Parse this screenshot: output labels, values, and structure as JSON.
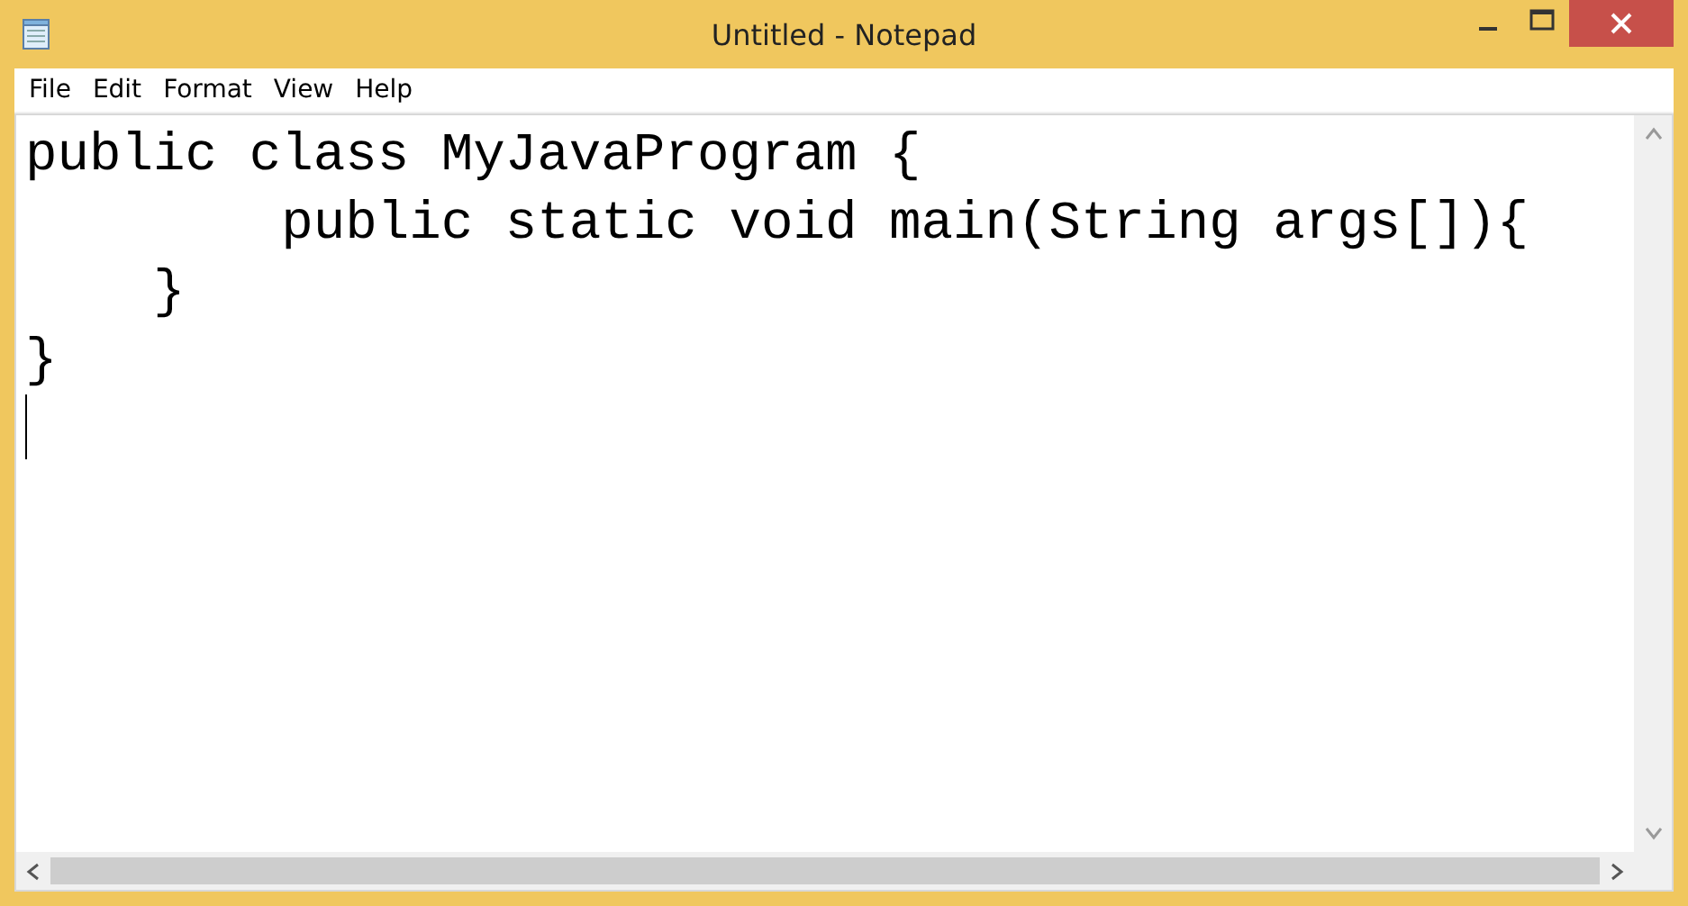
{
  "window": {
    "title": "Untitled - Notepad"
  },
  "menu": [
    "File",
    "Edit",
    "Format",
    "View",
    "Help"
  ],
  "editor": {
    "lines": [
      "public class MyJavaProgram {",
      "        public static void main(String args[]){",
      "    }",
      "}"
    ]
  }
}
